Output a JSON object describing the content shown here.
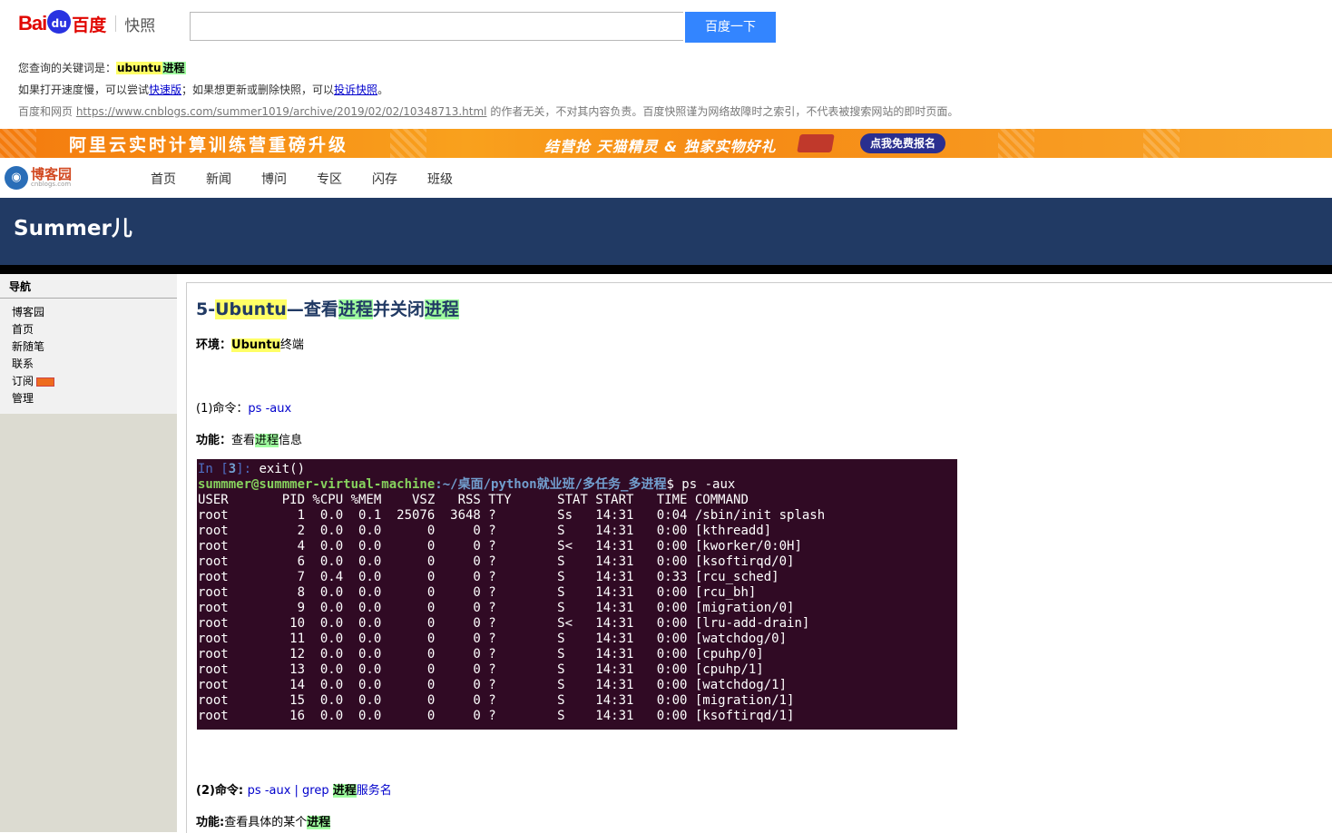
{
  "baidu": {
    "logo_bai": "Bai",
    "logo_du": "du",
    "logo_cn": "百度",
    "logo_snapshot": "快照",
    "search_value": "",
    "search_button": "百度一下",
    "keyword_label": "您查询的关键词是：",
    "keyword_1": "ubuntu",
    "keyword_2": "进程",
    "tip_1": "如果打开速度慢，可以尝试",
    "tip_link_fast": "快速版",
    "tip_2": "；如果想更新或删除快照，可以",
    "tip_link_complain": "投诉快照",
    "tip_3": "。",
    "disclaimer_1": "百度和网页 ",
    "disclaimer_url": "https://www.cnblogs.com/summer1019/archive/2019/02/02/10348713.html",
    "disclaimer_2": " 的作者无关，不对其内容负责。百度快照谨为网络故障时之索引，不代表被搜索网站的即时页面。"
  },
  "ad": {
    "headline": "阿里云实时计算训练营重磅升级",
    "promo": "结营抢 天猫精灵 & 独家实物好礼",
    "cta": "点我免费报名"
  },
  "cnblogs": {
    "logo_name": "博客园",
    "logo_sub": "cnblogs.com",
    "nav": [
      "首页",
      "新闻",
      "博问",
      "专区",
      "闪存",
      "班级"
    ]
  },
  "blog": {
    "title": "Summer儿",
    "sidebar_heading": "导航",
    "sidebar_items": [
      "博客园",
      "首页",
      "新随笔",
      "联系",
      "订阅",
      "管理"
    ]
  },
  "post": {
    "title_prefix": "5-",
    "title_kw1": "Ubuntu",
    "title_mid1": "—查看",
    "title_kw2": "进程",
    "title_mid2": "并关闭",
    "title_kw3": "进程",
    "env_label": "环境：",
    "env_kw": "Ubuntu",
    "env_rest": "终端",
    "cmd1_label": "(1)命令：",
    "cmd1_value": "ps -aux",
    "func1_label": "功能：",
    "func1_a": "查看",
    "func1_kw": "进程",
    "func1_b": "信息",
    "cmd2_label": "(2)命令: ",
    "cmd2_value": "ps -aux | grep ",
    "cmd2_kw": "进程",
    "cmd2_rest": "服务名",
    "func2_label": "功能:",
    "func2_a": "查看具体的某个",
    "func2_kw": "进程"
  },
  "terminal": {
    "in_prompt": "In [",
    "in_num": "3",
    "in_close": "]: ",
    "in_cmd": "exit()",
    "prompt_user": "summmer@summmer-virtual-machine",
    "prompt_path": ":~/桌面/python就业班/多任务_多进程",
    "prompt_cmd": "$ ps -aux",
    "header": "USER       PID %CPU %MEM    VSZ   RSS TTY      STAT START   TIME COMMAND",
    "rows": [
      "root         1  0.0  0.1  25076  3648 ?        Ss   14:31   0:04 /sbin/init splash",
      "root         2  0.0  0.0      0     0 ?        S    14:31   0:00 [kthreadd]",
      "root         4  0.0  0.0      0     0 ?        S<   14:31   0:00 [kworker/0:0H]",
      "root         6  0.0  0.0      0     0 ?        S    14:31   0:00 [ksoftirqd/0]",
      "root         7  0.4  0.0      0     0 ?        S    14:31   0:33 [rcu_sched]",
      "root         8  0.0  0.0      0     0 ?        S    14:31   0:00 [rcu_bh]",
      "root         9  0.0  0.0      0     0 ?        S    14:31   0:00 [migration/0]",
      "root        10  0.0  0.0      0     0 ?        S<   14:31   0:00 [lru-add-drain]",
      "root        11  0.0  0.0      0     0 ?        S    14:31   0:00 [watchdog/0]",
      "root        12  0.0  0.0      0     0 ?        S    14:31   0:00 [cpuhp/0]",
      "root        13  0.0  0.0      0     0 ?        S    14:31   0:00 [cpuhp/1]",
      "root        14  0.0  0.0      0     0 ?        S    14:31   0:00 [watchdog/1]",
      "root        15  0.0  0.0      0     0 ?        S    14:31   0:00 [migration/1]",
      "root        16  0.0  0.0      0     0 ?        S    14:31   0:00 [ksoftirqd/1]"
    ]
  }
}
